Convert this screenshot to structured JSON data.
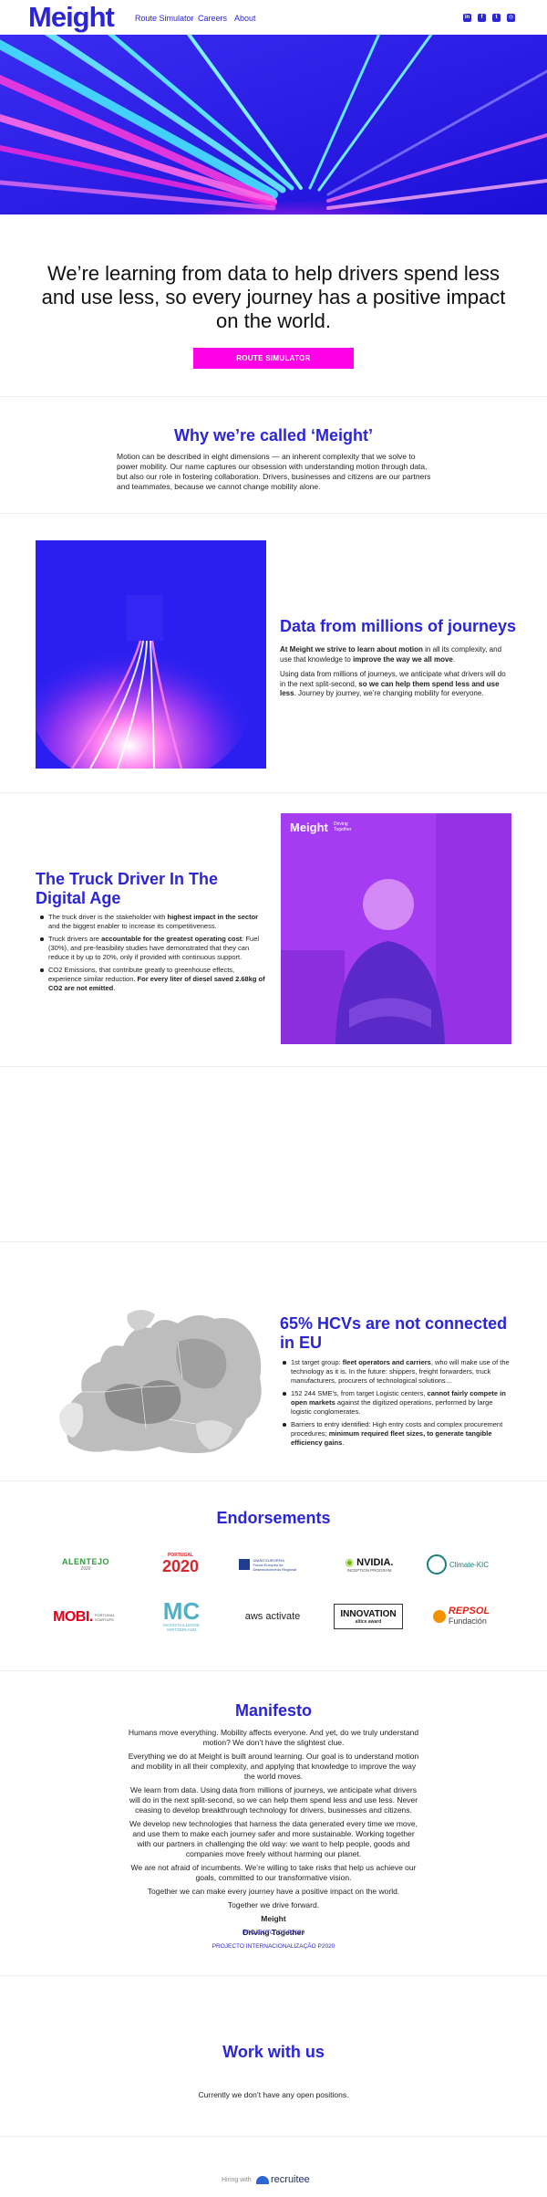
{
  "header": {
    "logo": "Meight",
    "nav": [
      "Route Simulator",
      "Careers",
      "About"
    ],
    "social": [
      {
        "icon": "linkedin-icon",
        "glyph": "in"
      },
      {
        "icon": "facebook-icon",
        "glyph": "f"
      },
      {
        "icon": "twitter-icon",
        "glyph": "t"
      },
      {
        "icon": "instagram-icon",
        "glyph": "◎"
      }
    ]
  },
  "intro": {
    "lead": "We’re learning from data to help drivers spend less and use less, so every journey has a positive impact on the world.",
    "button": "ROUTE SIMULATOR"
  },
  "why": {
    "title": "Why we’re called ‘Meight’",
    "text": "Motion can be described in eight dimensions — an inherent complexity that we solve to power mobility. Our name captures our obsession with understanding motion through data, but also our role in fostering collaboration. Drivers, businesses and citizens are our partners and teammates, because we cannot change mobility alone."
  },
  "data_section": {
    "title": "Data from millions of journeys",
    "p1_bold": "At Meight we strive to learn about motion",
    "p1_rest": " in all its complexity, and use that knowledge to ",
    "p1_bold2": "improve the way we all move",
    "p1_end": ".",
    "p2_start": "Using data from millions of journeys, we anticipate what drivers will do in the next split-second, ",
    "p2_bold": "so we can help them spend less and use less",
    "p2_end": ". Journey by journey, we’re changing mobility for everyone."
  },
  "truck": {
    "title": "The Truck Driver In The Digital Age",
    "image_logo": "Meight",
    "image_tag": "Driving\nTogether",
    "b1_a": "The truck driver is the stakeholder with ",
    "b1_b": "highest impact in the sector",
    "b1_c": " and the biggest enabler to increase its competitiveness.",
    "b2_a": "Truck drivers are ",
    "b2_b": "accountable for the greatest operating cost",
    "b2_c": ": Fuel (30%), and pre-feasibility studies have demonstrated that they can reduce it by up to 20%, only if provided with continuous support.",
    "b3_a": "CO2 Emissions, that contribute greatly to greenhouse effects, experience similar reduction. ",
    "b3_b": "For every liter of diesel saved 2.68kg of CO2 are not emitted",
    "b3_c": "."
  },
  "hcv": {
    "title": "65% HCVs are not connected in EU",
    "b1_a": "1st target group: ",
    "b1_b": "fleet operators and carriers",
    "b1_c": ", who will make use of the technology as it is. In the future: shippers, freight forwarders, truck manufacturers, procurers of technological solutions…",
    "b2_a": "152 244 SME’s, from target Logistic centers, ",
    "b2_b": "cannot fairly compete in open markets",
    "b2_c": " against the digitized operations, performed by large logistic conglomerates.",
    "b3_a": "Barriers to entry identified: High entry costs and complex procurement procedures; ",
    "b3_b": "minimum required fleet sizes, to generate tangible efficiency gains",
    "b3_c": "."
  },
  "endorsements": {
    "title": "Endorsements",
    "logos": [
      {
        "name": "alentejo-logo",
        "text": "ALENTEJO",
        "sub": "2020",
        "color": "#2e9b3a"
      },
      {
        "name": "portugal-2020-logo",
        "text": "2020",
        "sub": "PORTUGAL",
        "color": "#d7262d"
      },
      {
        "name": "eu-fund-logo",
        "text": "UNIÃO EUROPEIA",
        "sub": "Fundo Europeu de Desenvolvimento Regional",
        "color": "#1f3e8f"
      },
      {
        "name": "nvidia-logo",
        "text": "NVIDIA.",
        "sub": "INCEPTION PROGRAM",
        "color": "#111111"
      },
      {
        "name": "climate-kic-logo",
        "text": "Climate-KIC",
        "sub": "",
        "color": "#1a7f7b"
      },
      {
        "name": "mobi-logo",
        "text": "MOBI.",
        "sub": "PORTUGAL STARTUPS",
        "color": "#e3001b"
      },
      {
        "name": "masschallenge-logo",
        "text": "MC",
        "sub": "MASSCHALLENGE SWITZERLAND",
        "color": "#4fb0c6"
      },
      {
        "name": "aws-activate-logo",
        "text": "aws activate",
        "sub": "",
        "color": "#222222"
      },
      {
        "name": "altice-innovation-logo",
        "text": "INNOVATION",
        "sub": "altice award",
        "color": "#111111"
      },
      {
        "name": "repsol-logo",
        "text": "REPSOL",
        "sub": "Fundación",
        "color": "#e2231a"
      }
    ]
  },
  "manifesto": {
    "title": "Manifesto",
    "paragraphs": [
      "Humans move everything. Mobility affects everyone. And yet, do we truly understand motion? We don’t have the slightest clue.",
      "Everything we do at Meight is built around learning. Our goal is to understand motion and mobility in all their complexity, and applying that knowledge to improve the way the world moves.",
      "We learn from data. Using data from millions of journeys, we anticipate what drivers will do in the next split-second, so we can help them spend less and use less. Never ceasing to develop breakthrough technology for drivers, businesses and citizens.",
      "We develop new technologies that harness the data generated every time we move, and use them to make each journey safer and more sustainable. Working together with our partners in challenging the old way: we want to help people, goods and companies move freely without harming our planet.",
      "We are not afraid of incumbents. We’re willing to take risks that help us achieve our goals, committed to our transformative vision.",
      "Together we can make every journey have a positive impact on the world.",
      "Together we drive forward."
    ],
    "sign1": "Meight",
    "sign2": "Driving Together",
    "link1": "PROJECTO IOT P2020",
    "link2": "PROJECTO INTERNACIONALIZAÇÃO P2020"
  },
  "work": {
    "title": "Work with us",
    "text": "Currently we don’t have any open positions."
  },
  "footer": {
    "hiring": "Hiring with",
    "brand": "recruitee"
  },
  "colors": {
    "brand": "#2b25d6",
    "magenta": "#ff00e6"
  }
}
